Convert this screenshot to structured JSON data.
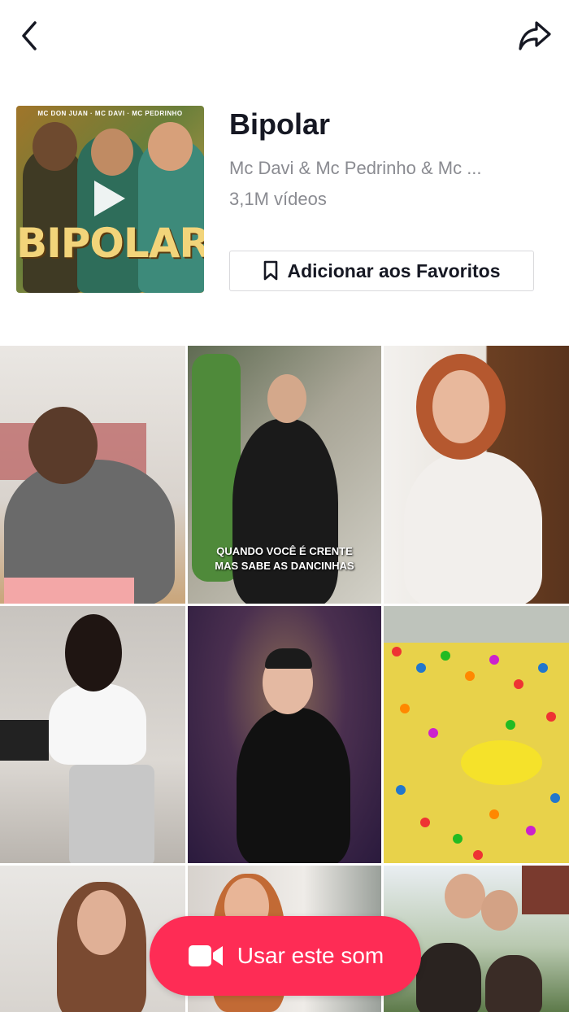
{
  "nav": {
    "back_icon": "chevron-left-icon",
    "share_icon": "share-arrow-icon"
  },
  "sound": {
    "title": "Bipolar",
    "artist": "Mc Davi & Mc Pedrinho & Mc ...",
    "video_count": "3,1M vídeos",
    "favorite_label": "Adicionar aos Favoritos",
    "favorite_icon": "bookmark-icon",
    "cover_title": "BIPOLAR",
    "cover_topline": "MC DON JUAN · MC DAVI · MC PEDRINHO",
    "cover_play_icon": "play-icon"
  },
  "videos": [
    {
      "caption": ""
    },
    {
      "caption": "QUANDO VOCÊ É CRENTE\nMAS SABE AS DANCINHAS"
    },
    {
      "caption": ""
    },
    {
      "caption": ""
    },
    {
      "caption": ""
    },
    {
      "caption": ""
    },
    {
      "caption": ""
    },
    {
      "caption": ""
    },
    {
      "caption": ""
    }
  ],
  "cta": {
    "label": "Usar este som",
    "icon": "video-camera-icon",
    "color": "#fe2c55"
  }
}
